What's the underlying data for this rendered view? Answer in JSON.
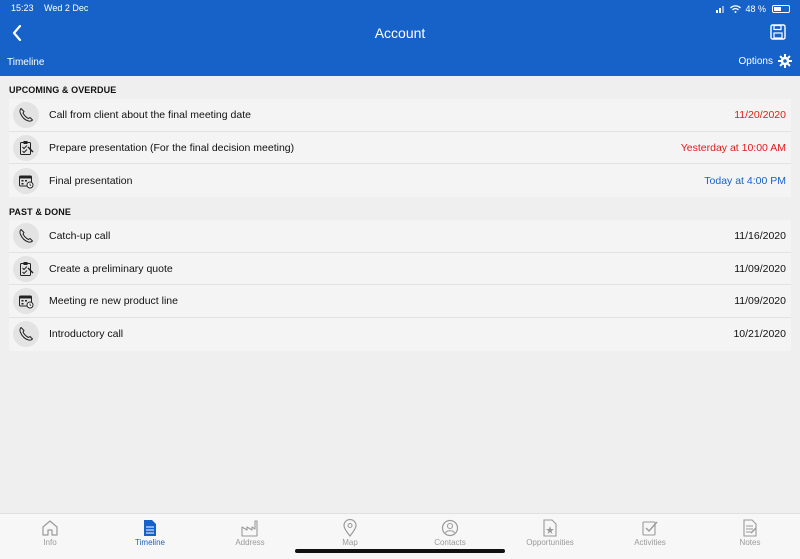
{
  "status": {
    "time": "15:23",
    "date": "Wed 2 Dec",
    "battery": "48 %"
  },
  "header": {
    "title": "Account",
    "subtab": "Timeline",
    "options_label": "Options"
  },
  "upcoming": {
    "heading": "UPCOMING & OVERDUE",
    "items": [
      {
        "icon": "phone-icon",
        "label": "Call from client about the final meeting date",
        "date": "11/20/2020",
        "date_color": "red"
      },
      {
        "icon": "task-icon",
        "label": "Prepare presentation (For the final decision meeting)",
        "date": "Yesterday at 10:00 AM",
        "date_color": "red"
      },
      {
        "icon": "meeting-icon",
        "label": "Final presentation",
        "date": "Today at 4:00 PM",
        "date_color": "blue"
      }
    ]
  },
  "past": {
    "heading": "PAST & DONE",
    "items": [
      {
        "icon": "phone-icon",
        "label": "Catch-up call",
        "date": "11/16/2020"
      },
      {
        "icon": "task-icon",
        "label": "Create a preliminary quote",
        "date": "11/09/2020"
      },
      {
        "icon": "meeting-icon",
        "label": "Meeting re new product line",
        "date": "11/09/2020"
      },
      {
        "icon": "phone-icon",
        "label": "Introductory call",
        "date": "10/21/2020"
      }
    ]
  },
  "tabs": [
    {
      "label": "Info",
      "icon": "home-icon"
    },
    {
      "label": "Timeline",
      "icon": "document-icon",
      "active": true
    },
    {
      "label": "Address",
      "icon": "factory-icon"
    },
    {
      "label": "Map",
      "icon": "map-pin-icon"
    },
    {
      "label": "Contacts",
      "icon": "contact-icon"
    },
    {
      "label": "Opportunities",
      "icon": "opportunity-icon"
    },
    {
      "label": "Activities",
      "icon": "checklist-icon"
    },
    {
      "label": "Notes",
      "icon": "notes-icon"
    }
  ],
  "colors": {
    "accent": "#1762c8",
    "overdue": "#e11b1b"
  }
}
